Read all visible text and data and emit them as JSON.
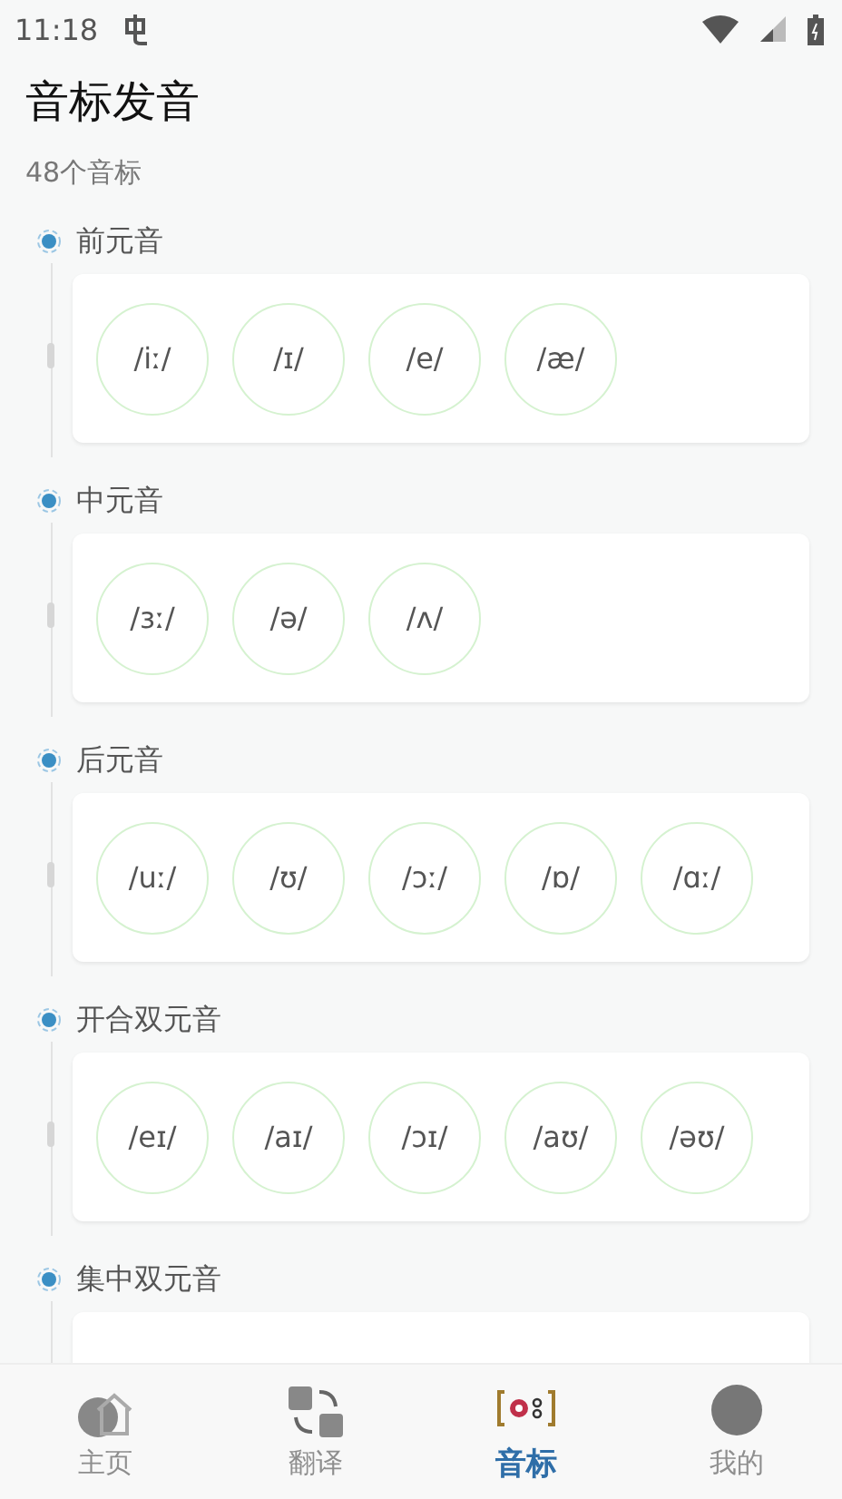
{
  "status_bar": {
    "time": "11:18"
  },
  "title": "音标发音",
  "count": "48个音标",
  "sections": [
    {
      "title": "前元音",
      "phonemes": [
        "/iː/",
        "/ɪ/",
        "/e/",
        "/æ/"
      ]
    },
    {
      "title": "中元音",
      "phonemes": [
        "/ɜː/",
        "/ə/",
        "/ʌ/"
      ]
    },
    {
      "title": "后元音",
      "phonemes": [
        "/uː/",
        "/ʊ/",
        "/ɔː/",
        "/ɒ/",
        "/ɑː/"
      ]
    },
    {
      "title": "开合双元音",
      "phonemes": [
        "/eɪ/",
        "/aɪ/",
        "/ɔɪ/",
        "/aʊ/",
        "/əʊ/"
      ]
    },
    {
      "title": "集中双元音"
    }
  ],
  "nav": [
    {
      "label": "主页",
      "kind": "home",
      "selected": false
    },
    {
      "label": "翻译",
      "kind": "translate",
      "selected": false
    },
    {
      "label": "音标",
      "kind": "phonetic",
      "selected": true
    },
    {
      "label": "我的",
      "kind": "profile",
      "selected": false
    }
  ]
}
